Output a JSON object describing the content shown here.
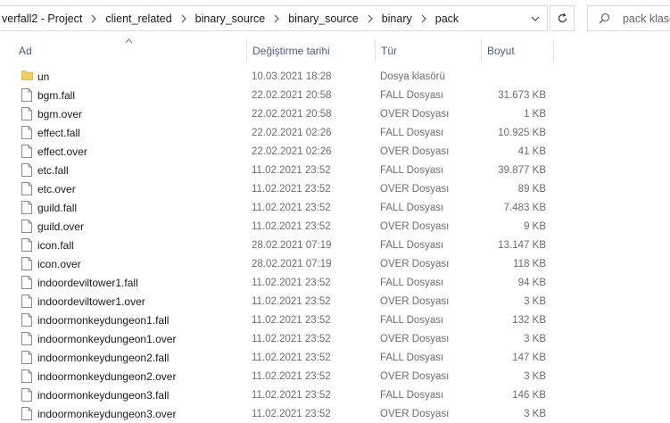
{
  "breadcrumb": [
    "verfall2 - Project",
    "client_related",
    "binary_source",
    "binary_source",
    "binary",
    "pack"
  ],
  "search": {
    "placeholder": "pack klasö"
  },
  "columns": {
    "name": "Ad",
    "date": "Değiştirme tarihi",
    "type": "Tür",
    "size": "Boyut"
  },
  "icons": {
    "folder": "folder-icon",
    "file": "file-icon",
    "folder_color": "#f3cf62",
    "file_stroke": "#8a8a8a"
  },
  "files": [
    {
      "name": "un",
      "date": "10.03.2021 18:28",
      "type": "Dosya klasörü",
      "size": "",
      "kind": "folder"
    },
    {
      "name": "bgm.fall",
      "date": "22.02.2021 20:58",
      "type": "FALL Dosyası",
      "size": "31.673 KB",
      "kind": "file"
    },
    {
      "name": "bgm.over",
      "date": "22.02.2021 20:58",
      "type": "OVER Dosyası",
      "size": "1 KB",
      "kind": "file"
    },
    {
      "name": "effect.fall",
      "date": "22.02.2021 02:26",
      "type": "FALL Dosyası",
      "size": "10.925 KB",
      "kind": "file"
    },
    {
      "name": "effect.over",
      "date": "22.02.2021 02:26",
      "type": "OVER Dosyası",
      "size": "41 KB",
      "kind": "file"
    },
    {
      "name": "etc.fall",
      "date": "11.02.2021 23:52",
      "type": "FALL Dosyası",
      "size": "39.877 KB",
      "kind": "file"
    },
    {
      "name": "etc.over",
      "date": "11.02.2021 23:52",
      "type": "OVER Dosyası",
      "size": "89 KB",
      "kind": "file"
    },
    {
      "name": "guild.fall",
      "date": "11.02.2021 23:52",
      "type": "FALL Dosyası",
      "size": "7.483 KB",
      "kind": "file"
    },
    {
      "name": "guild.over",
      "date": "11.02.2021 23:52",
      "type": "OVER Dosyası",
      "size": "9 KB",
      "kind": "file"
    },
    {
      "name": "icon.fall",
      "date": "28.02.2021 07:19",
      "type": "FALL Dosyası",
      "size": "13.147 KB",
      "kind": "file"
    },
    {
      "name": "icon.over",
      "date": "28.02.2021 07:19",
      "type": "OVER Dosyası",
      "size": "118 KB",
      "kind": "file"
    },
    {
      "name": "indoordeviltower1.fall",
      "date": "11.02.2021 23:52",
      "type": "FALL Dosyası",
      "size": "94 KB",
      "kind": "file"
    },
    {
      "name": "indoordeviltower1.over",
      "date": "11.02.2021 23:52",
      "type": "OVER Dosyası",
      "size": "3 KB",
      "kind": "file"
    },
    {
      "name": "indoormonkeydungeon1.fall",
      "date": "11.02.2021 23:52",
      "type": "FALL Dosyası",
      "size": "132 KB",
      "kind": "file"
    },
    {
      "name": "indoormonkeydungeon1.over",
      "date": "11.02.2021 23:52",
      "type": "OVER Dosyası",
      "size": "3 KB",
      "kind": "file"
    },
    {
      "name": "indoormonkeydungeon2.fall",
      "date": "11.02.2021 23:52",
      "type": "FALL Dosyası",
      "size": "147 KB",
      "kind": "file"
    },
    {
      "name": "indoormonkeydungeon2.over",
      "date": "11.02.2021 23:52",
      "type": "OVER Dosyası",
      "size": "3 KB",
      "kind": "file"
    },
    {
      "name": "indoormonkeydungeon3.fall",
      "date": "11.02.2021 23:52",
      "type": "FALL Dosyası",
      "size": "146 KB",
      "kind": "file"
    },
    {
      "name": "indoormonkeydungeon3.over",
      "date": "11.02.2021 23:52",
      "type": "OVER Dosyası",
      "size": "3 KB",
      "kind": "file"
    }
  ]
}
